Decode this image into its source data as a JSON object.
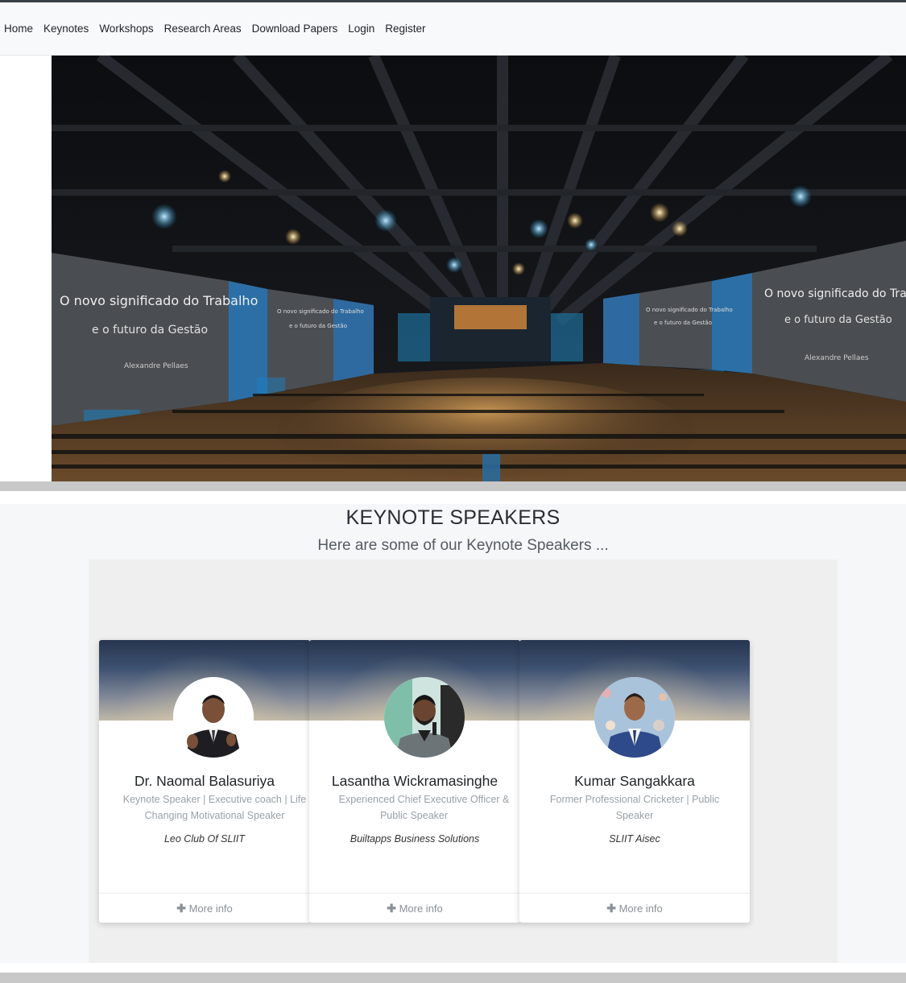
{
  "nav": {
    "links": [
      "Home",
      "Keynotes",
      "Workshops",
      "Research Areas",
      "Download Papers",
      "Login",
      "Register"
    ]
  },
  "hero": {
    "screen_left_line1": "O novo significado do Trabalho",
    "screen_left_line2": "e o futuro da Gestão",
    "screen_left_name": "Alexandre Pellaes",
    "screen_right_line1": "O novo significado do Trabalh",
    "screen_right_line2": "e o futuro da Gestão",
    "screen_right_name": "Alexandre Pellaes",
    "mid_left_line1": "O novo significado do Trabalho",
    "mid_left_line2": "e o futuro da Gestão",
    "mid_right_line1": "O novo significado do Trabalho",
    "mid_right_line2": "e o futuro da Gestão"
  },
  "keynotes": {
    "title": "KEYNOTE SPEAKERS",
    "subtitle": "Here are some of our Keynote Speakers ...",
    "more_label": "More info",
    "speakers": [
      {
        "name": "Dr. Naomal Balasuriya",
        "role_line1": "Keynote Speaker | Executive coach | Life",
        "role_line2": "Changing Motivational Speaker",
        "org": "Leo Club Of SLIIT"
      },
      {
        "name": "Lasantha Wickramasinghe",
        "role_line1": "Experienced Chief Executive Officer &",
        "role_line2": "Public Speaker",
        "org": "Builtapps Business Solutions"
      },
      {
        "name": "Kumar Sangakkara",
        "role_line1": "Former Professional Cricketer | Public",
        "role_line2": "Speaker",
        "org": "SLIIT Aisec"
      }
    ]
  },
  "colors": {
    "navbar_bg": "#f8f9fa",
    "section_bg": "#f6f7f9",
    "panel_bg": "#efefef",
    "separator": "#c8c8c8",
    "muted_text": "#9aa0a6",
    "stage_blue": "#1e90c8"
  },
  "icons": {
    "more_info": "plus-icon"
  }
}
